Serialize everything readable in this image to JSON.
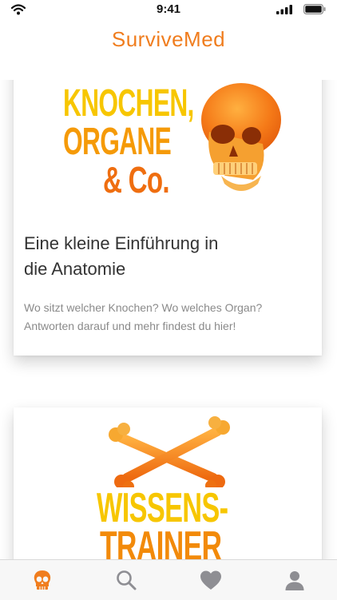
{
  "status": {
    "time": "9:41"
  },
  "header": {
    "title": "SurviveMed"
  },
  "cards": [
    {
      "cover_lines": [
        "KNOCHEN,",
        "ORGANE",
        "& Co."
      ],
      "title_line1": "Eine kleine Einführung in",
      "title_line2": "die Anatomie",
      "description": "Wo sitzt welcher Knochen? Wo welches Organ? Antworten darauf und mehr findest du hier!"
    },
    {
      "cover_lines": [
        "WISSENS-",
        "TRAINER"
      ]
    }
  ],
  "tabs": [
    {
      "icon": "skull-icon",
      "active": true
    },
    {
      "icon": "search-icon",
      "active": false
    },
    {
      "icon": "heart-icon",
      "active": false
    },
    {
      "icon": "profile-icon",
      "active": false
    }
  ],
  "colors": {
    "accent": "#f07d1e",
    "cover_yellow": "#f7c600",
    "cover_orange": "#ef7a12",
    "tab_inactive": "#8e8e93"
  }
}
